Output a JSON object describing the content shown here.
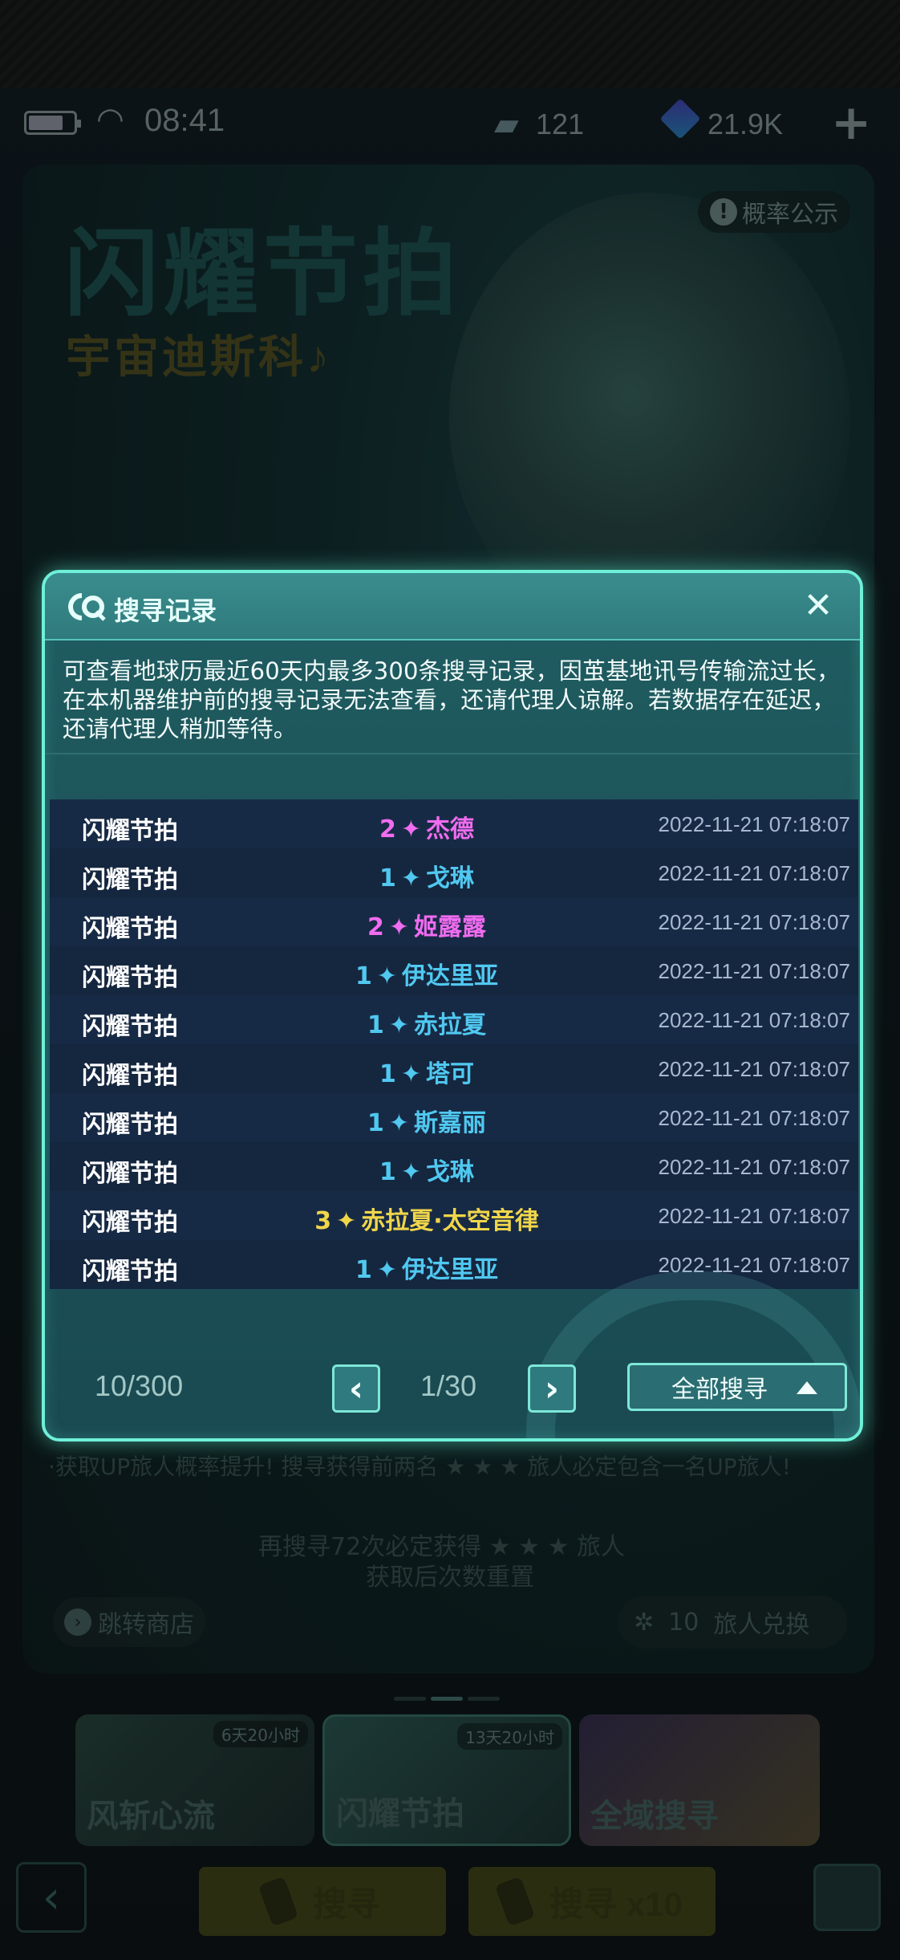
{
  "status_bar": {
    "time": "08:41",
    "tickets": "121",
    "gems": "21.9K"
  },
  "background": {
    "banner_title": "闪耀节拍",
    "banner_subtitle": "宇宙迪斯科♪",
    "probability_button": "概率公示",
    "up_text": "·获取UP旅人概率提升! 搜寻获得前两名 ★ ★ ★ 旅人必定包含一名UP旅人!",
    "pity_text_1": "再搜寻72次必定获得 ★ ★ ★ 旅人",
    "pity_text_2": "获取后次数重置",
    "shop_button": "跳转商店",
    "exchange_count": "10",
    "exchange_label": "旅人兑换",
    "tabs": [
      {
        "label": "风斩心流",
        "timer": "6天20小时"
      },
      {
        "label": "闪耀节拍",
        "timer": "13天20小时"
      },
      {
        "label": "全域搜寻",
        "timer": ""
      }
    ],
    "search_single": "搜寻",
    "search_ten": "搜寻 x10"
  },
  "modal": {
    "title": "搜寻记录",
    "notice": "可查看地球历最近60天内最多300条搜寻记录，因茧基地讯号传输流过长，在本机器维护前的搜寻记录无法查看，还请代理人谅解。若数据存在延迟，还请代理人稍加等待。",
    "records": [
      {
        "pool": "闪耀节拍",
        "rarity": "2",
        "name": "杰德",
        "rank": "r2",
        "time": "2022-11-21 07:18:07"
      },
      {
        "pool": "闪耀节拍",
        "rarity": "1",
        "name": "戈琳",
        "rank": "r1",
        "time": "2022-11-21 07:18:07"
      },
      {
        "pool": "闪耀节拍",
        "rarity": "2",
        "name": "姬露露",
        "rank": "r2",
        "time": "2022-11-21 07:18:07"
      },
      {
        "pool": "闪耀节拍",
        "rarity": "1",
        "name": "伊达里亚",
        "rank": "r1",
        "time": "2022-11-21 07:18:07"
      },
      {
        "pool": "闪耀节拍",
        "rarity": "1",
        "name": "赤拉夏",
        "rank": "r1",
        "time": "2022-11-21 07:18:07"
      },
      {
        "pool": "闪耀节拍",
        "rarity": "1",
        "name": "塔可",
        "rank": "r1",
        "time": "2022-11-21 07:18:07"
      },
      {
        "pool": "闪耀节拍",
        "rarity": "1",
        "name": "斯嘉丽",
        "rank": "r1",
        "time": "2022-11-21 07:18:07"
      },
      {
        "pool": "闪耀节拍",
        "rarity": "1",
        "name": "戈琳",
        "rank": "r1",
        "time": "2022-11-21 07:18:07"
      },
      {
        "pool": "闪耀节拍",
        "rarity": "3",
        "name": "赤拉夏·太空音律",
        "rank": "r3",
        "time": "2022-11-21 07:18:07"
      },
      {
        "pool": "闪耀节拍",
        "rarity": "1",
        "name": "伊达里亚",
        "rank": "r1",
        "time": "2022-11-21 07:18:07"
      }
    ],
    "count": "10/300",
    "page": "1/30",
    "filter": "全部搜寻"
  },
  "colors": {
    "rarity_1": "#50c8f0",
    "rarity_2": "#f06cf0",
    "rarity_3": "#f0d64a",
    "accent": "#6ff0d8"
  }
}
